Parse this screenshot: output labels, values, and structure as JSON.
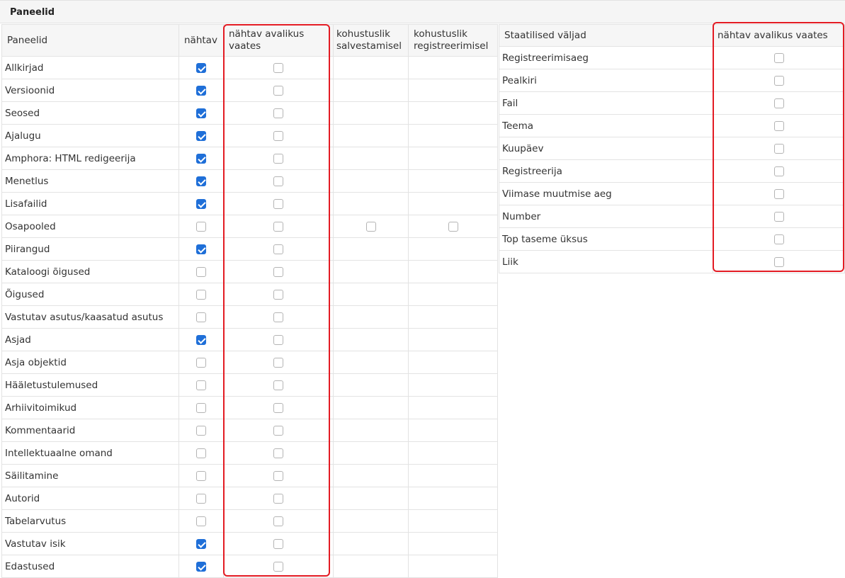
{
  "section": {
    "title": "Paneelid"
  },
  "panels_table": {
    "headers": {
      "name": "Paneelid",
      "visible": "nähtav",
      "public_line1": "nähtav avalikus",
      "public_line2": "vaates",
      "req_save_line1": "kohustuslik",
      "req_save_line2": "salvestamisel",
      "req_reg_line1": "kohustuslik",
      "req_reg_line2": "registreerimisel"
    },
    "rows": [
      {
        "name": "Allkirjad",
        "visible": true,
        "public": false
      },
      {
        "name": "Versioonid",
        "visible": true,
        "public": false
      },
      {
        "name": "Seosed",
        "visible": true,
        "public": false
      },
      {
        "name": "Ajalugu",
        "visible": true,
        "public": false
      },
      {
        "name": "Amphora: HTML redigeerija",
        "visible": true,
        "public": false
      },
      {
        "name": "Menetlus",
        "visible": true,
        "public": false
      },
      {
        "name": "Lisafailid",
        "visible": true,
        "public": false
      },
      {
        "name": "Osapooled",
        "visible": false,
        "public": false,
        "req_save": false,
        "req_reg": false
      },
      {
        "name": "Piirangud",
        "visible": true,
        "public": false
      },
      {
        "name": "Kataloogi õigused",
        "visible": false,
        "public": false
      },
      {
        "name": "Õigused",
        "visible": false,
        "public": false
      },
      {
        "name": "Vastutav asutus/kaasatud asutus",
        "visible": false,
        "public": false
      },
      {
        "name": "Asjad",
        "visible": true,
        "public": false
      },
      {
        "name": "Asja objektid",
        "visible": false,
        "public": false
      },
      {
        "name": "Hääletustulemused",
        "visible": false,
        "public": false
      },
      {
        "name": "Arhiivitoimikud",
        "visible": false,
        "public": false
      },
      {
        "name": "Kommentaarid",
        "visible": false,
        "public": false
      },
      {
        "name": "Intellektuaalne omand",
        "visible": false,
        "public": false
      },
      {
        "name": "Säilitamine",
        "visible": false,
        "public": false
      },
      {
        "name": "Autorid",
        "visible": false,
        "public": false
      },
      {
        "name": "Tabelarvutus",
        "visible": false,
        "public": false
      },
      {
        "name": "Vastutav isik",
        "visible": true,
        "public": false
      },
      {
        "name": "Edastused",
        "visible": true,
        "public": false
      }
    ]
  },
  "static_table": {
    "headers": {
      "name": "Staatilised väljad",
      "public": "nähtav avalikus vaates"
    },
    "rows": [
      {
        "name": "Registreerimisaeg",
        "public": false
      },
      {
        "name": "Pealkiri",
        "public": false
      },
      {
        "name": "Fail",
        "public": false
      },
      {
        "name": "Teema",
        "public": false
      },
      {
        "name": "Kuupäev",
        "public": false
      },
      {
        "name": "Registreerija",
        "public": false
      },
      {
        "name": "Viimase muutmise aeg",
        "public": false
      },
      {
        "name": "Number",
        "public": false
      },
      {
        "name": "Top taseme üksus",
        "public": false
      },
      {
        "name": "Liik",
        "public": false
      }
    ]
  },
  "colors": {
    "checkbox_checked": "#1f6fd8",
    "highlight": "#e31b23",
    "header_bg": "#f6f6f6"
  },
  "icons": {
    "checkbox": "checkbox-icon"
  }
}
